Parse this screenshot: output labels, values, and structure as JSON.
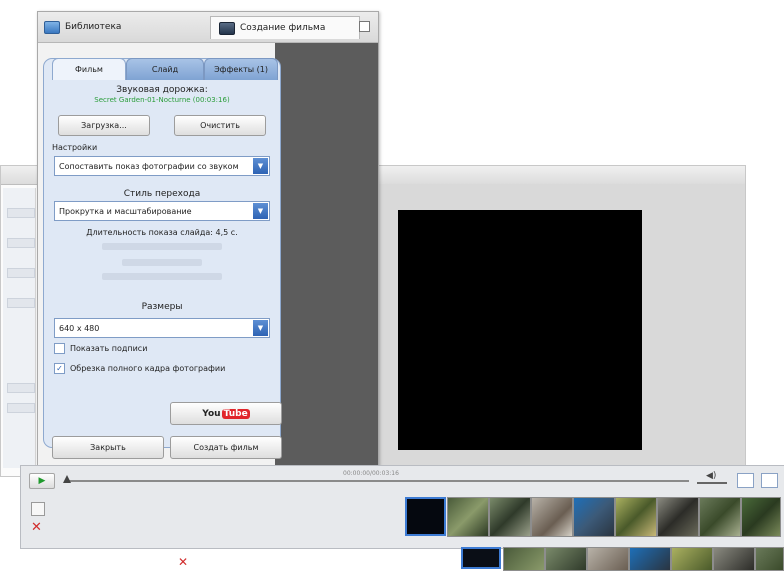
{
  "dialog": {
    "tabs": [
      "Библиотека",
      "Создание фильма"
    ]
  },
  "panel": {
    "tabs": [
      "Фильм",
      "Слайд",
      "Эффекты (1)"
    ],
    "audio_heading": "Звуковая дорожка:",
    "audio_track": "Secret Garden-01-Nocturne (00:03:16)",
    "load_button": "Загрузка...",
    "clear_button": "Очистить",
    "settings_label": "Настройки",
    "settings_select": "Сопоставить показ фотографии со звуком",
    "transition_heading": "Стиль перехода",
    "transition_select": "Прокрутка и масштабирование",
    "duration_label": "Длительность показа слайда: 4,5 с.",
    "size_heading": "Размеры",
    "size_select": "640 x 480",
    "checkbox_captions": "Показать подписи",
    "checkbox_crop": "Обрезка полного кадра фотографии",
    "youtube_you": "You",
    "youtube_tube": "Tube",
    "close_button": "Закрыть",
    "create_button": "Создать фильм"
  },
  "timeline": {
    "time_label": "00:00:00/00:03:16"
  },
  "colors": {
    "accent": "#2e63b4",
    "audio_track_text": "#2a9d3a",
    "youtube_red": "#e1252b",
    "delete_red": "#d12c2c"
  },
  "icons": [
    "library-icon",
    "film-icon",
    "restore-icon",
    "dropdown-arrow-icon",
    "check-icon",
    "play-icon",
    "volume-icon",
    "delete-icon"
  ]
}
